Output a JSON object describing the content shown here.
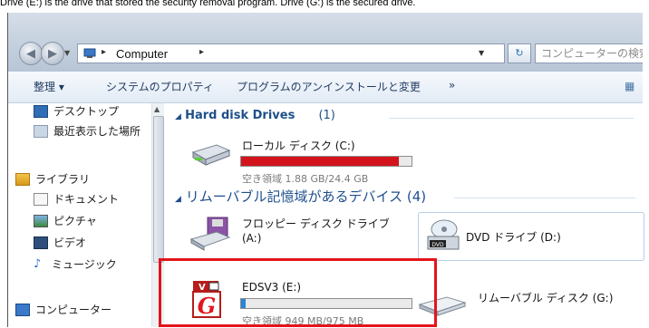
{
  "caption": "Drive (E:) is the drive that stored the security removal program. Drive (G:) is the secured drive.",
  "address_bar": {
    "location": "Computer",
    "search_placeholder": "コンピューターの検索"
  },
  "toolbar": {
    "organize": "整理 ▾",
    "system_properties": "システムのプロパティ",
    "uninstall": "プログラムのアンインストールと変更",
    "more": "»"
  },
  "sidebar": {
    "items": [
      {
        "label": "デスクトップ",
        "icon": "desktop-icon"
      },
      {
        "label": "最近表示した場所",
        "icon": "recent-places-icon"
      },
      {
        "label": "ライブラリ",
        "icon": "libraries-icon"
      },
      {
        "label": "ドキュメント",
        "icon": "documents-icon"
      },
      {
        "label": "ピクチャ",
        "icon": "pictures-icon"
      },
      {
        "label": "ビデオ",
        "icon": "videos-icon"
      },
      {
        "label": "ミュージック",
        "icon": "music-icon"
      },
      {
        "label": "コンピューター",
        "icon": "computer-icon"
      }
    ]
  },
  "groups": {
    "hdd": {
      "title": "Hard disk Drives",
      "count": "(1)"
    },
    "removable": {
      "title": "リムーバブル記憶域があるデバイス",
      "count": "(4)"
    }
  },
  "drives": {
    "c": {
      "name": "ローカル ディスク (C:)",
      "free": "空き領域 1.88 GB/24.4 GB",
      "used_fraction": 0.923,
      "bar_color": "#d4141c"
    },
    "floppy": {
      "name": "フロッピー ディスク ドライブ",
      "name2": "(A:)"
    },
    "dvd": {
      "name": "DVD ドライブ (D:)"
    },
    "e": {
      "name": "EDSV3 (E:)",
      "free": "空き領域 949 MB/975 MB",
      "used_fraction": 0.027,
      "bar_color": "#2a86d6"
    },
    "g": {
      "name": "リムーバブル ディスク (G:)"
    }
  },
  "colors": {
    "highlight": "#e3141b",
    "group_text": "#1e4f8a"
  }
}
